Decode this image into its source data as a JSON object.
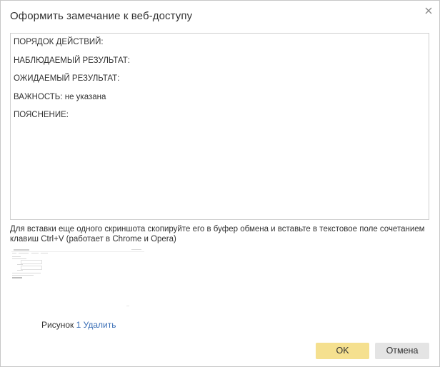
{
  "dialog": {
    "title": "Оформить замечание к веб-доступу",
    "close_icon": "close-icon"
  },
  "report": {
    "lines": [
      "ПОРЯДОК ДЕЙСТВИЙ:",
      "НАБЛЮДАЕМЫЙ РЕЗУЛЬТАТ:",
      "ОЖИДАЕМЫЙ РЕЗУЛЬТАТ:",
      "ВАЖНОСТЬ: не указана",
      "ПОЯСНЕНИЕ:"
    ]
  },
  "hint": "Для вставки еще одного скриншота скопируйте его в буфер обмена и вставьте в текстовое поле сочетанием клавиш Ctrl+V (работает в Chrome и Opera)",
  "attachment": {
    "caption_label": "Рисунок",
    "caption_number": "1",
    "delete_label": "Удалить"
  },
  "buttons": {
    "ok_label": "OK",
    "cancel_label": "Отмена"
  },
  "colors": {
    "ok_bg": "#f5e08f",
    "cancel_bg": "#e4e4e4",
    "link": "#3b6fb6"
  }
}
